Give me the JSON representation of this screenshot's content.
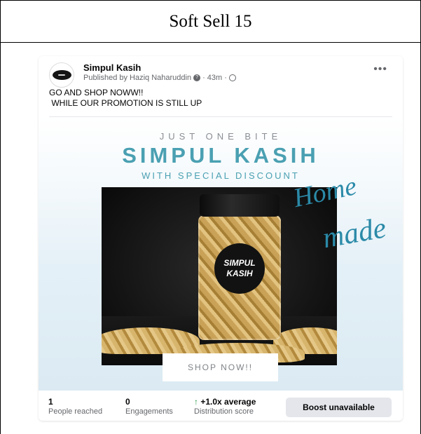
{
  "document": {
    "title": "Soft Sell 15"
  },
  "post": {
    "page_name": "Simpul Kasih",
    "published_by": "Published by Haziq Naharuddin",
    "time": "43m",
    "separator": "·",
    "caption_lines": [
      "GO AND SHOP NOWW!!",
      " WHILE OUR PROMOTION IS STILL UP"
    ],
    "more_icon": "more-horizontal-icon"
  },
  "promo": {
    "tagline": "JUST ONE BITE",
    "brand": "SIMPUL KASIH",
    "subtitle": "WITH SPECIAL DISCOUNT",
    "script_1": "Home",
    "script_2": "made",
    "jar_label_1": "SIMPUL",
    "jar_label_2": "KASIH",
    "cta": "SHOP NOW!!",
    "accent_color": "#4aa0b2"
  },
  "stats": {
    "reached_value": "1",
    "reached_label": "People reached",
    "engagements_value": "0",
    "engagements_label": "Engagements",
    "distribution_arrow": "↑",
    "distribution_value": "+1.0x average",
    "distribution_label": "Distribution score",
    "boost_label": "Boost unavailable"
  }
}
